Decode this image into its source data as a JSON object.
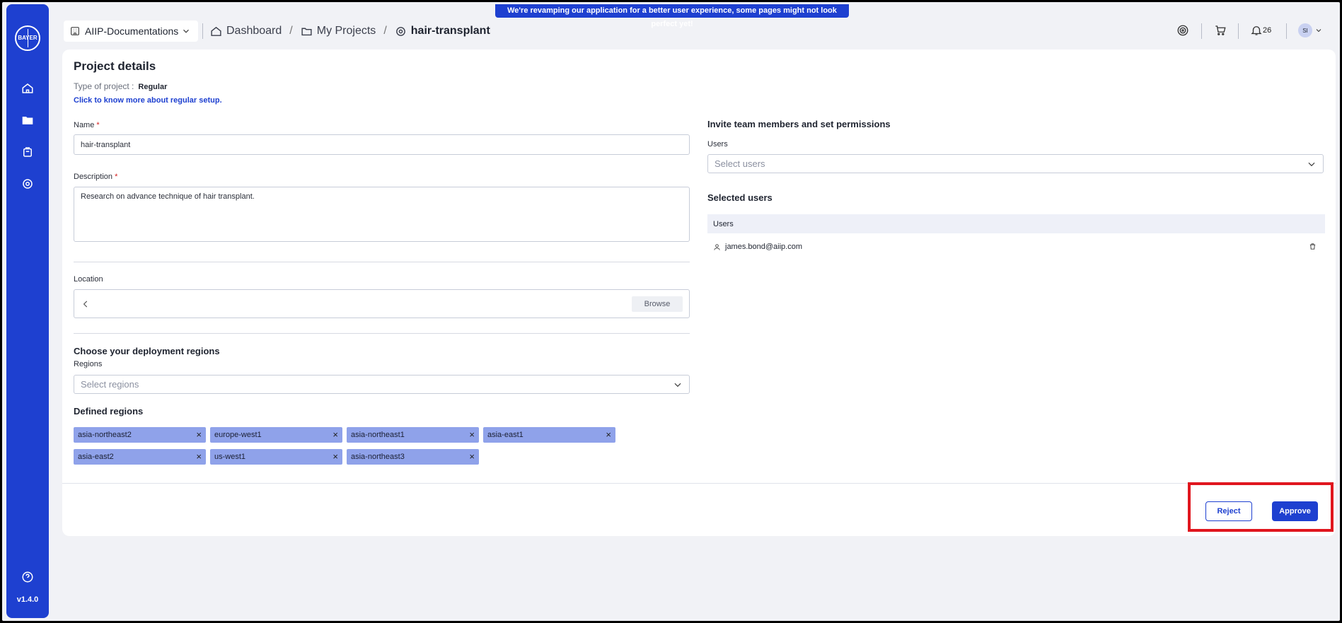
{
  "banner": "We're revamping our application for a better user experience, some pages might not look perfect yet!",
  "sidebar": {
    "logo_text": "BAYER",
    "items": [
      "home-icon",
      "folder-icon",
      "package-icon",
      "settings-icon"
    ],
    "help_icon": "help-icon",
    "version": "v1.4.0"
  },
  "workspace": {
    "label": "AIIP-Documentations"
  },
  "breadcrumb": {
    "dashboard": "Dashboard",
    "projects": "My Projects",
    "current": "hair-transplant"
  },
  "toolbar": {
    "notifications_count": "26",
    "avatar_initials": "SI"
  },
  "project": {
    "title": "Project details",
    "type_label": "Type of project :",
    "type_value": "Regular",
    "learn_more": "Click to know more about regular setup.",
    "name_label": "Name",
    "name_required": "*",
    "name_value": "hair-transplant",
    "description_label": "Description",
    "description_required": "*",
    "description_value": "Research on advance technique of hair transplant.",
    "location_label": "Location",
    "location_value": "",
    "browse_label": "Browse",
    "regions_section": "Choose your deployment regions",
    "regions_label": "Regions",
    "regions_placeholder": "Select regions",
    "defined_regions_title": "Defined regions",
    "defined_regions": [
      "asia-northeast2",
      "europe-west1",
      "asia-northeast1",
      "asia-east1",
      "asia-east2",
      "us-west1",
      "asia-northeast3"
    ]
  },
  "team": {
    "title": "Invite team members and set permissions",
    "users_label": "Users",
    "users_placeholder": "Select users",
    "selected_title": "Selected users",
    "table_header": "Users",
    "users": [
      "james.bond@aiip.com"
    ]
  },
  "actions": {
    "reject": "Reject",
    "approve": "Approve"
  },
  "colors": {
    "accent": "#1e40d0",
    "chip": "#8fa2ea",
    "highlight": "#e0161e"
  }
}
